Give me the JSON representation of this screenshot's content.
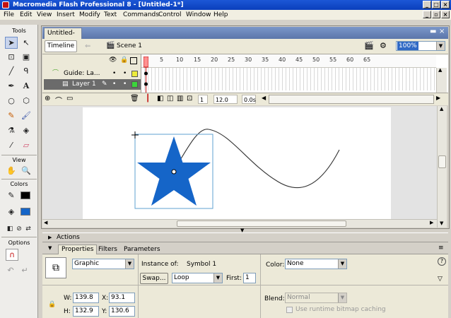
{
  "window": {
    "title": "Macromedia Flash Professional 8 - [Untitled-1*]"
  },
  "menu": [
    "File",
    "Edit",
    "View",
    "Insert",
    "Modify",
    "Text",
    "Commands",
    "Control",
    "Window",
    "Help"
  ],
  "tools": {
    "header": "Tools",
    "view_label": "View",
    "colors_label": "Colors",
    "options_label": "Options"
  },
  "document": {
    "tab": "Untitled-1*",
    "timeline_button": "Timeline",
    "scene": "Scene 1",
    "zoom": "100%"
  },
  "timeline": {
    "frame_numbers": [
      "5",
      "10",
      "15",
      "20",
      "25",
      "30",
      "35",
      "40",
      "45",
      "50",
      "55",
      "60",
      "65"
    ],
    "layers": [
      {
        "name": "Guide: La...",
        "selected": false
      },
      {
        "name": "Layer 1",
        "selected": true
      }
    ],
    "current_frame": "1",
    "fps": "12.0 fps",
    "time": "0.0s"
  },
  "panels": {
    "actions": "Actions",
    "tabs": [
      "Properties",
      "Filters",
      "Parameters"
    ]
  },
  "properties": {
    "symbol_type": "Graphic",
    "instance_of_label": "Instance of:",
    "instance_of_value": "Symbol 1",
    "swap_label": "Swap...",
    "loop_value": "Loop",
    "first_label": "First:",
    "first_value": "1",
    "color_label": "Color:",
    "color_value": "None",
    "w_label": "W:",
    "w_value": "139.8",
    "h_label": "H:",
    "h_value": "132.9",
    "x_label": "X:",
    "x_value": "93.1",
    "y_label": "Y:",
    "y_value": "130.6",
    "blend_label": "Blend:",
    "blend_value": "Normal",
    "cache_label": "Use runtime bitmap caching"
  },
  "colors": {
    "title_bar": "#0a3fbc",
    "star": "#1565c8",
    "fill_swatch": "#1565c8",
    "stroke_swatch": "#000000"
  }
}
